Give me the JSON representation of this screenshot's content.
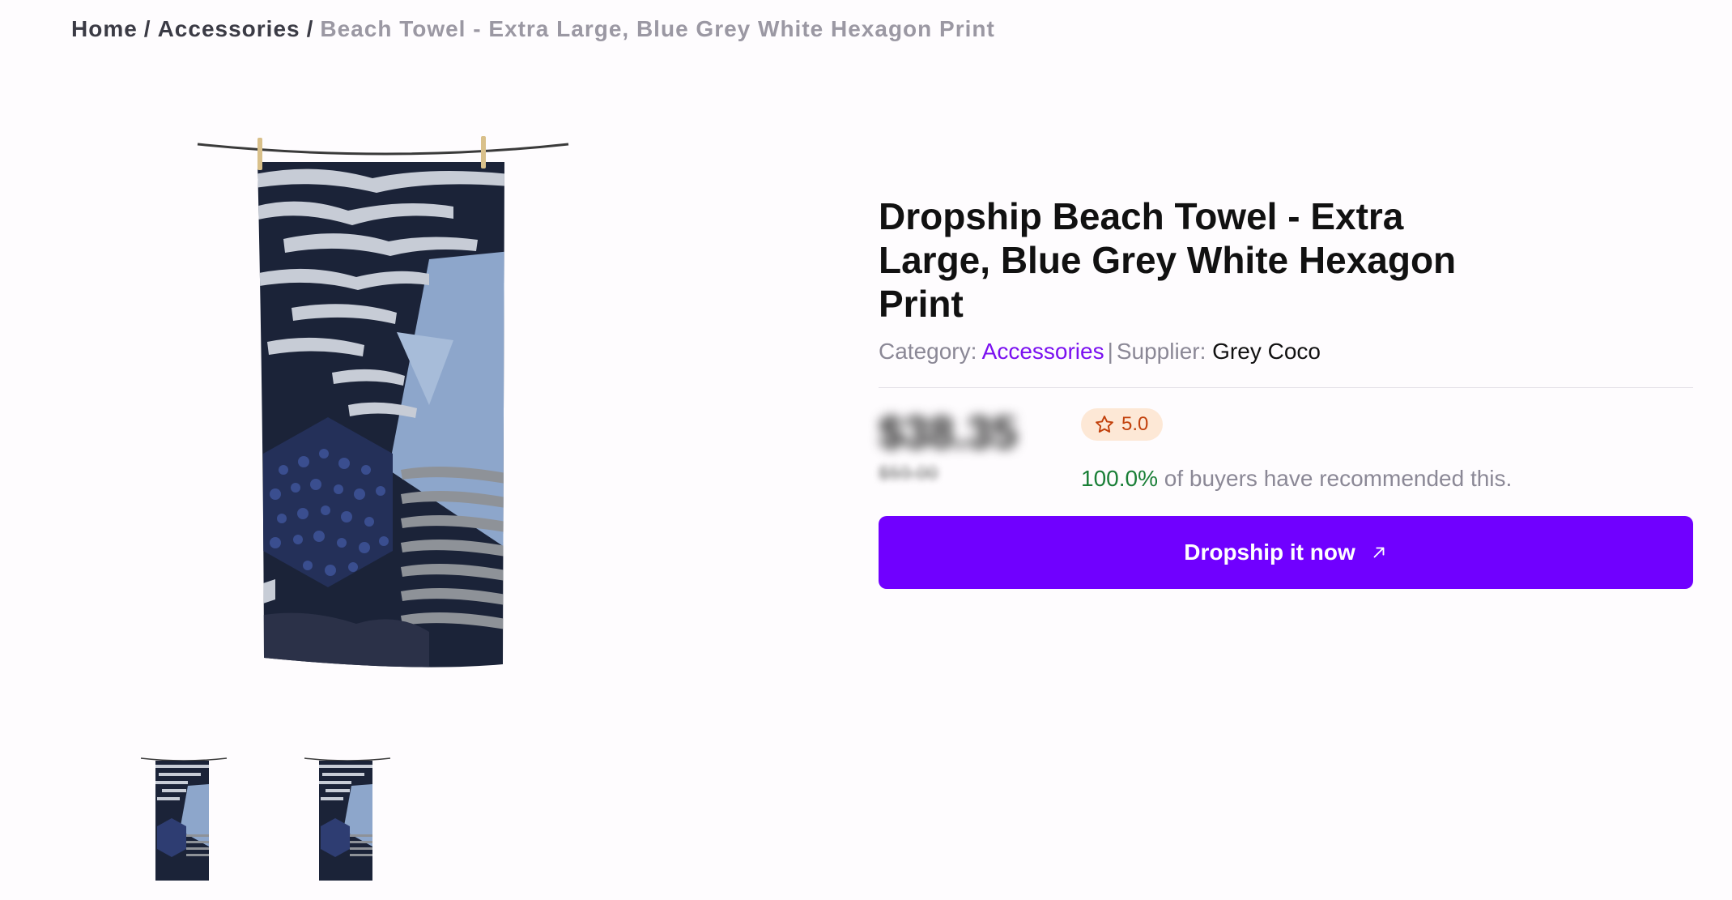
{
  "breadcrumb": {
    "home": "Home",
    "separator": "/",
    "category": "Accessories",
    "current": "Beach Towel - Extra Large, Blue Grey White Hexagon Print"
  },
  "product": {
    "title": "Dropship Beach Towel - Extra Large, Blue Grey White Hexagon Print",
    "category_label": "Category:",
    "category_value": "Accessories",
    "divider": "|",
    "supplier_label": "Supplier:",
    "supplier_value": "Grey Coco",
    "price": "$38.35",
    "old_price": "$59.00",
    "rating": "5.0",
    "recommend_pct": "100.0%",
    "recommend_text": "of buyers have recommended this.",
    "cta_label": "Dropship it now"
  },
  "icons": {
    "star": "star-outline-icon",
    "cta": "arrow-up-right-icon"
  },
  "colors": {
    "accent": "#7000ff",
    "link": "#7a10f0",
    "rating_bg": "#fde8d6",
    "rating_fg": "#c2410c",
    "positive": "#1a7f37"
  }
}
